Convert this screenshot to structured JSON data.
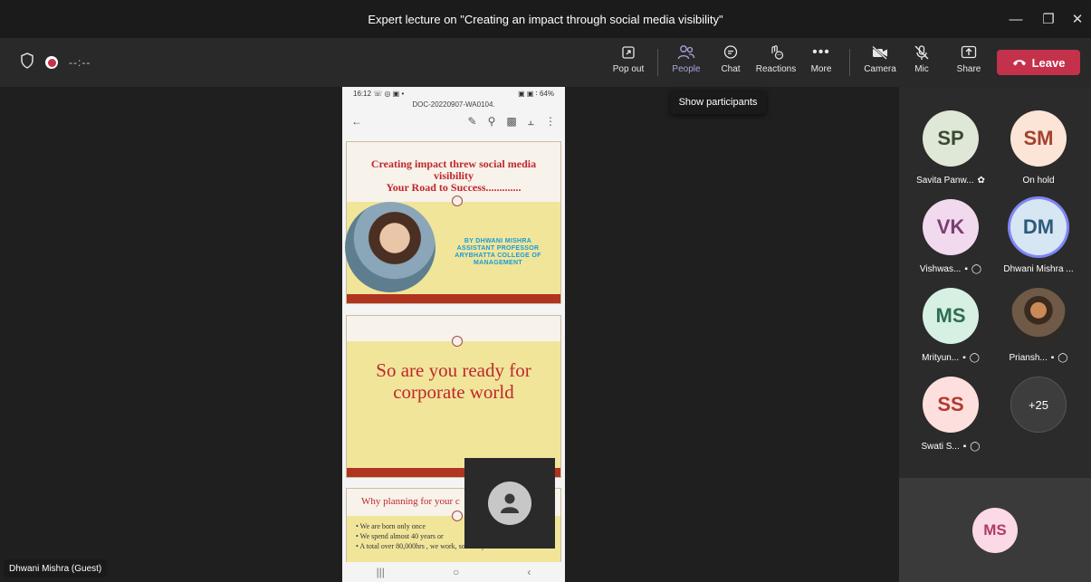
{
  "window": {
    "title": "Expert lecture on \"Creating an impact through social media visibility\""
  },
  "toolbar": {
    "timer": "--:--",
    "pop_out": "Pop out",
    "people": "People",
    "chat": "Chat",
    "reactions": "Reactions",
    "more": "More",
    "camera": "Camera",
    "mic": "Mic",
    "share": "Share",
    "leave": "Leave"
  },
  "tooltip": "Show participants",
  "shared_screen": {
    "status_time": "16:12 ☏ ◎ ▣ •",
    "status_right": "▣ ▣ ∶ 64%",
    "doc_name": "DOC-20220907-WA0104.",
    "slide1": {
      "title_l1": "Creating impact threw social media",
      "title_l2": "visibility",
      "title_l3": "Your Road to Success.............",
      "by_l1": "BY DHWANI MISHRA",
      "by_l2": "ASSISTANT PROFESSOR",
      "by_l3": "ARYBHATTA COLLEGE OF",
      "by_l4": "MANAGEMENT"
    },
    "slide2": {
      "line1": "So  are you ready for",
      "line2": "corporate world"
    },
    "slide3": {
      "title": "Why planning for your c",
      "b1": "• We are born only once",
      "b2": "• We spend almost 40 years or",
      "b3": "• A total over 80,000hrs , we work, so how you want"
    }
  },
  "presenter_badge": "Dhwani Mishra (Guest)",
  "participants": [
    {
      "initials": "SP",
      "name": "Savita Panw...",
      "bg": "#dfe7d6",
      "fg": "#3b4a34"
    },
    {
      "initials": "SM",
      "name": "On hold",
      "bg": "#fce4d6",
      "fg": "#a3412e"
    },
    {
      "initials": "VK",
      "name": "Vishwas...",
      "bg": "#f1d9ee",
      "fg": "#7a3f72"
    },
    {
      "initials": "DM",
      "name": "Dhwani Mishra ...",
      "bg": "#d6e6f3",
      "fg": "#2e5a7a"
    },
    {
      "initials": "MS",
      "name": "Mrityun...",
      "bg": "#d6f0e3",
      "fg": "#2f6e4f"
    },
    {
      "initials": "",
      "name": "Priansh...",
      "bg": "#5a4a3a",
      "fg": "#ffffff"
    },
    {
      "initials": "SS",
      "name": "Swati S...",
      "bg": "#fde0dd",
      "fg": "#b23b32"
    },
    {
      "initials": "+25",
      "name": "",
      "bg": "#3d3d3d",
      "fg": "#ffffff"
    }
  ],
  "bottom_avatar": {
    "initials": "MS",
    "bg": "#fbd9e7",
    "fg": "#b03a67"
  },
  "icons": [
    "shield-icon",
    "record-icon",
    "popout-icon",
    "people-icon",
    "chat-icon",
    "reactions-icon",
    "more-icon",
    "camera-off-icon",
    "mic-off-icon",
    "share-icon",
    "phone-hangup-icon",
    "minimize-icon",
    "maximize-icon",
    "close-icon"
  ],
  "colors": {
    "leave": "#c4314b",
    "active": "#a6a7dc",
    "slide_red": "#c0272d",
    "slide_yellow": "#f1e59a"
  }
}
